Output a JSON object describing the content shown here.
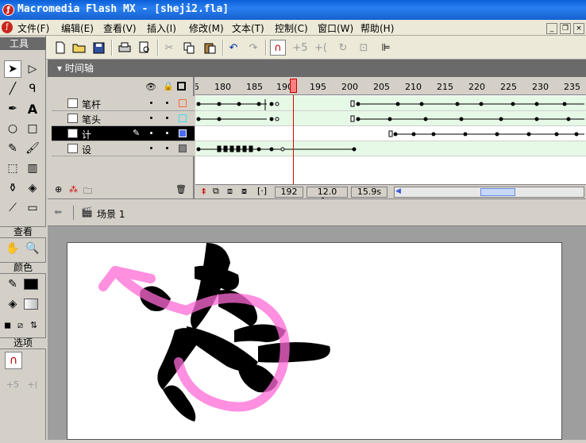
{
  "window": {
    "title": "Macromedia Flash MX - [sheji2.fla]"
  },
  "menu": [
    "文件(F)",
    "编辑(E)",
    "查看(V)",
    "插入(I)",
    "修改(M)",
    "文本(T)",
    "控制(C)",
    "窗口(W)",
    "帮助(H)"
  ],
  "tools_panel": {
    "title": "工具",
    "view_label": "查看",
    "colors_label": "颜色",
    "options_label": "选项",
    "stroke_color": "#000000",
    "fill_color": "#d8d4cc"
  },
  "timeline": {
    "title": "时间轴",
    "ruler": [
      "5",
      "180",
      "185",
      "190",
      "195",
      "200",
      "205",
      "210",
      "215",
      "220",
      "225",
      "230",
      "235"
    ],
    "layers": [
      {
        "name": "笔杆",
        "color": "#ff6a3c",
        "active": false
      },
      {
        "name": "笔头",
        "color": "#38e0e8",
        "active": false
      },
      {
        "name": "计",
        "color": "#4a6cf0",
        "active": true
      },
      {
        "name": "设",
        "color": "#808080",
        "active": false
      }
    ],
    "status": {
      "frame": "192",
      "fps": "12.0 fps",
      "time": "15.9s"
    }
  },
  "scene": {
    "label": "场景 1"
  },
  "colors": {
    "accent_pen": "#ff6ad5",
    "playhead": "#e00000"
  }
}
